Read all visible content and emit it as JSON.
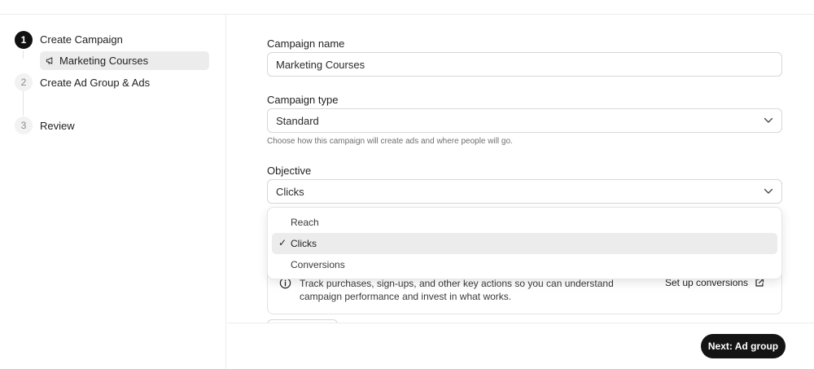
{
  "steps": [
    {
      "number": "1",
      "label": "Create Campaign"
    },
    {
      "number": "2",
      "label": "Create Ad Group & Ads"
    },
    {
      "number": "3",
      "label": "Review"
    }
  ],
  "current_campaign": {
    "label": "Marketing Courses",
    "icon": "megaphone-icon"
  },
  "form": {
    "campaign_name": {
      "label": "Campaign name",
      "value": "Marketing Courses"
    },
    "campaign_type": {
      "label": "Campaign type",
      "value": "Standard",
      "help": "Choose how this campaign will create ads and where people will go."
    },
    "objective": {
      "label": "Objective",
      "value": "Clicks",
      "options": [
        {
          "label": "Reach",
          "selected": false
        },
        {
          "label": "Clicks",
          "selected": true
        },
        {
          "label": "Conversions",
          "selected": false
        }
      ],
      "check_mark": "✓"
    }
  },
  "info": {
    "text": "Track purchases, sign-ups, and other key actions so you can understand campaign performance and invest in what works.",
    "link_label": "Set up conversions"
  },
  "footer": {
    "next_label": "Next: Ad group"
  },
  "colors": {
    "accent": "#141414",
    "selected_bg": "#ececec",
    "border": "#d7d7d7"
  }
}
